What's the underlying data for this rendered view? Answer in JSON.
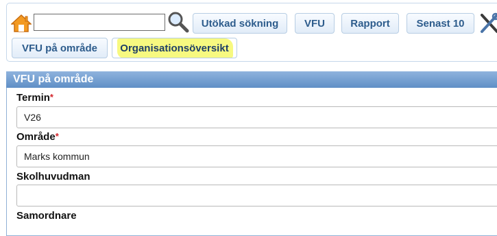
{
  "toolbar": {
    "search_value": "",
    "buttons": {
      "utokad": "Utökad sökning",
      "vfu": "VFU",
      "rapport": "Rapport",
      "senast": "Senast 10",
      "vfu_omrade": "VFU på område",
      "organisation": "Organisationsöversikt"
    }
  },
  "panel": {
    "title": "VFU på område",
    "fields": [
      {
        "label": "Termin",
        "required": "*",
        "value": "V26"
      },
      {
        "label": "Område",
        "required": "*",
        "value": "Marks kommun"
      },
      {
        "label": "Skolhuvudman",
        "required": "",
        "value": ""
      },
      {
        "label": "Samordnare",
        "required": "",
        "value": ""
      }
    ]
  },
  "colors": {
    "accent": "#5f8fc6",
    "button_text": "#2d5c8c",
    "highlight": "#f6f86a",
    "required": "#d2232a"
  },
  "icons": [
    "home-icon",
    "search-icon",
    "tools-icon"
  ]
}
